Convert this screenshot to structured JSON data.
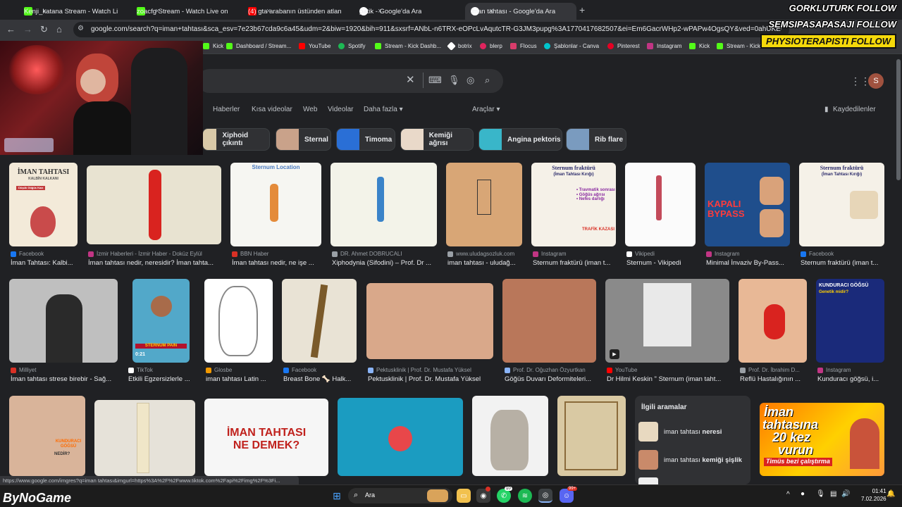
{
  "tabs": [
    {
      "label": "Kenji_katana Stream - Watch Li",
      "color": "#53fc18"
    },
    {
      "label": "zoacfg Stream - Watch Live on",
      "color": "#53fc18"
    },
    {
      "label": "(4) gta arabanın üstünden atlan",
      "color": "#ff0000"
    },
    {
      "label": "patik - Google'da Ara",
      "color": "#ffffff"
    },
    {
      "label": "iman tahtası - Google'da Ara",
      "color": "#ffffff"
    }
  ],
  "address": {
    "url": "google.com/search?q=iman+tahtası&sca_esv=7e23b67cda9c6a45&udm=2&biw=1920&bih=911&sxsrf=ANbL-n6TRX-eOPcLvAqutcTR-G3JM3pupg%3A1770417682507&ei=Em6GacrWHp2-wPAPw4OgsQY&ved=0ahUKEwjKp8fo98WSAx..."
  },
  "bookmarks": [
    {
      "label": "Kick",
      "color": "#53fc18"
    },
    {
      "label": "Dashboard / Stream...",
      "color": "#53fc18"
    },
    {
      "label": "YouTube",
      "color": "#ff0000"
    },
    {
      "label": "Spotify",
      "color": "#1db954"
    },
    {
      "label": "Stream - Kick Dashb...",
      "color": "#53fc18"
    },
    {
      "label": "botrix",
      "color": "#ffffff"
    },
    {
      "label": "blerp",
      "color": "#e0245e"
    },
    {
      "label": "Flocus",
      "color": "#d93c6b"
    },
    {
      "label": "Şablonlar - Canva",
      "color": "#00c4cc"
    },
    {
      "label": "Pinterest",
      "color": "#e60023"
    },
    {
      "label": "Instagram",
      "color": "#c13584"
    },
    {
      "label": "Kick",
      "color": "#53fc18"
    },
    {
      "label": "Stream - Kick Dashb...",
      "color": "#53fc18"
    }
  ],
  "nav_tabs": [
    "Haberler",
    "Kısa videolar",
    "Web",
    "Videolar",
    "Daha fazla ▾",
    "Araçlar ▾"
  ],
  "saved_label": "Kaydedilenler",
  "account_initial": "S",
  "chips": [
    {
      "label": "Xiphoid çıkıntı",
      "color": "#d9c9a8"
    },
    {
      "label": "Sternal",
      "color": "#c9a28a"
    },
    {
      "label": "Timoma",
      "color": "#2a6fd6"
    },
    {
      "label": "Kemiği ağrısı",
      "color": "#e9d9c9"
    },
    {
      "label": "Angina pektoris",
      "color": "#39b6c9"
    },
    {
      "label": "Rib flare",
      "color": "#7a9bbf"
    }
  ],
  "row1": [
    {
      "source": "Facebook",
      "title": "İman Tahtası: Kalbi...",
      "src_color": "#1877f2"
    },
    {
      "source": "İzmir Haberleri - İzmir Haber - Doküz Eylül",
      "title": "İman tahtası nedir, neresidir? İman tahta...",
      "src_color": "#c13584"
    },
    {
      "source": "BBN Haber",
      "title": "İman tahtası nedir, ne işe ...",
      "src_color": "#d93025"
    },
    {
      "source": "DR. Ahmet DOBRUCALI",
      "title": "Xiphodynia (Sifodini) – Prof. Dr ...",
      "src_color": "#9aa0a6"
    },
    {
      "source": "www.uludagsozluk.com",
      "title": "iman tahtası - uludağ...",
      "src_color": "#9aa0a6"
    },
    {
      "source": "Instagram",
      "title": "Sternum fraktürü (iman t...",
      "src_color": "#c13584"
    },
    {
      "source": "Vikipedi",
      "title": "Sternum - Vikipedi",
      "src_color": "#ffffff"
    },
    {
      "source": "Instagram",
      "title": "Minimal İnvaziv By-Pass...",
      "src_color": "#c13584"
    },
    {
      "source": "Facebook",
      "title": "Sternum fraktürü (iman t...",
      "src_color": "#1877f2"
    }
  ],
  "row2": [
    {
      "source": "Milliyet",
      "title": "İman tahtası strese birebir - Sağ...",
      "src_color": "#d93025"
    },
    {
      "source": "TikTok",
      "title": "Etkili Egzersizlerle ...",
      "src_color": "#ffffff"
    },
    {
      "source": "Glosbe",
      "title": "iman tahtası Latin ...",
      "src_color": "#f29900"
    },
    {
      "source": "Facebook",
      "title": "Breast Bone 🦴 Halk...",
      "src_color": "#1877f2"
    },
    {
      "source": "Pektusklinik | Prof. Dr. Mustafa Yüksel",
      "title": "Pektusklinik | Prof. Dr. Mustafa Yüksel",
      "src_color": "#8ab4f8"
    },
    {
      "source": "Prof. Dr. Oğuzhan Özyurtkan",
      "title": "Göğüs Duvarı Deformiteleri...",
      "src_color": "#8ab4f8"
    },
    {
      "source": "YouTube",
      "title": "Dr Hilmi Keskin \" Sternum (iman taht...",
      "src_color": "#ff0000"
    },
    {
      "source": "Prof. Dr. İbrahim D...",
      "title": "Reflü Hastalığının ...",
      "src_color": "#9aa0a6"
    },
    {
      "source": "Instagram",
      "title": "Kunduracı göğsü, i...",
      "src_color": "#c13584"
    }
  ],
  "image_text": {
    "iman_card_title": "İMAN TAHTASI",
    "iman_card_sub": "KALBİN KALKANI",
    "iman_card_tag": "Düşük Göğüs Kazı",
    "sternum_location": "Sternum Location",
    "frakture_title": "Sternum fraktürü",
    "frakture_sub": "(İman Tahtası Kırığı)",
    "frakture_list": "• Travmatik sonrası\n• Göğüs ağrısı\n• Nefes darlığı",
    "trafik": "TRAFİK KAZASI",
    "bypass": "KAPALI BYPASS",
    "kunduraci_title": "KUNDURACI GÖĞSÜ",
    "kunduraci_sub": "Genetik midir?",
    "tiktok_banner": "STERNUM PAIN",
    "tiktok_duration": "0:21",
    "kunduraci_small": "KUNDURACI GÖĞSÜ",
    "kunduraci_small_q": "NEDİR?",
    "ne_demek": "İMAN TAHTASI\nNE DEMEK?",
    "promo_line1": "İman",
    "promo_line2": "tahtasına",
    "promo_line3": "20 kez",
    "promo_line4": "vurun",
    "promo_line5": "Timüs bezi çalıştırma"
  },
  "related": {
    "heading": "İlgili aramalar",
    "items": [
      {
        "prefix": "iman tahtası ",
        "bold": "neresi"
      },
      {
        "prefix": "iman tahtası ",
        "bold": "kemiği şişlik"
      }
    ]
  },
  "status_url": "https://www.google.com/imgres?q=iman tahtası&imgurl=https%3A%2F%2Fwww.tiktok.com%2Fapi%2Fimg%2F%3Fi...",
  "taskbar": {
    "search_placeholder": "Ara",
    "time": "01:41",
    "date": "7.02.2026",
    "badges": [
      "10",
      "99+"
    ]
  },
  "overlay": {
    "follow_lines": [
      "GORKLUTURK FOLLOW",
      "SEMSIPASAPASAJI FOLLOW",
      "PHYSIOTERAPISTI FOLLOW"
    ],
    "brand": "ByNoGame"
  }
}
